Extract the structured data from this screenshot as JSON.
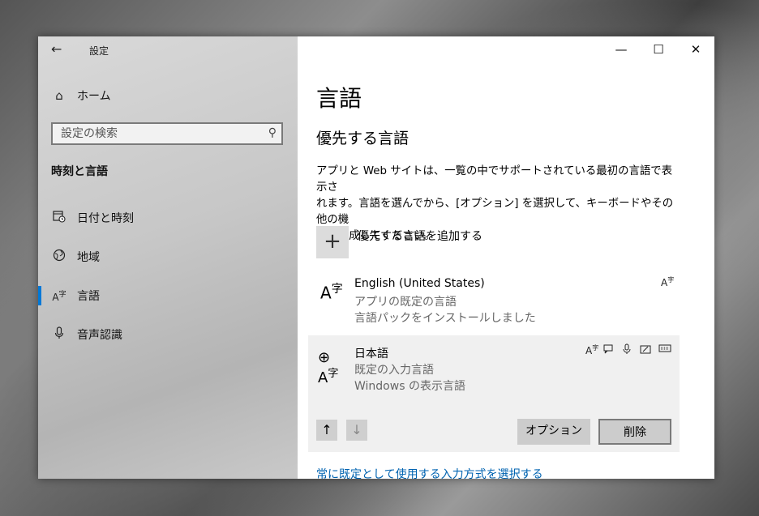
{
  "window": {
    "title": "設定",
    "back_icon": "arrow-left-icon",
    "controls": {
      "minimize": "—",
      "maximize": "☐",
      "close": "✕"
    }
  },
  "sidebar": {
    "home": {
      "icon": "home-icon",
      "label": "ホーム"
    },
    "search": {
      "placeholder": "設定の検索",
      "icon": "search-icon"
    },
    "section_title": "時刻と言語",
    "items": [
      {
        "icon": "calendar-clock-icon",
        "label": "日付と時刻",
        "selected": false
      },
      {
        "icon": "globe-region-icon",
        "label": "地域",
        "selected": false
      },
      {
        "icon": "language-icon",
        "label": "言語",
        "selected": true
      },
      {
        "icon": "microphone-icon",
        "label": "音声認識",
        "selected": false
      }
    ]
  },
  "main": {
    "title": "言語",
    "subtitle": "優先する言語",
    "description_lines": [
      "アプリと Web サイトは、一覧の中でサポートされている最初の言語で表示さ",
      "れます。言語を選んでから、[オプション] を選択して、キーボードやその他の機",
      "能を構成してください。"
    ],
    "add_language": {
      "icon": "plus-icon",
      "label": "優先する言語を追加する"
    },
    "languages": [
      {
        "name": "English (United States)",
        "status": [
          "アプリの既定の言語",
          "言語パックをインストールしました"
        ],
        "features": [
          "display-language-icon"
        ]
      },
      {
        "name": "日本語",
        "status": [
          "既定の入力言語",
          "Windows の表示言語"
        ],
        "features": [
          "display-language-icon",
          "speech-icon",
          "microphone-icon",
          "handwriting-icon",
          "keyboard-icon"
        ]
      }
    ],
    "move_up_icon": "arrow-up-icon",
    "move_down_icon": "arrow-down-icon",
    "options_label": "オプション",
    "remove_label": "削除",
    "link": "常に既定として使用する入力方式を選択する"
  },
  "colors": {
    "accent": "#0078d7",
    "link": "#0063b1",
    "card_bg": "#f0f0f0"
  }
}
